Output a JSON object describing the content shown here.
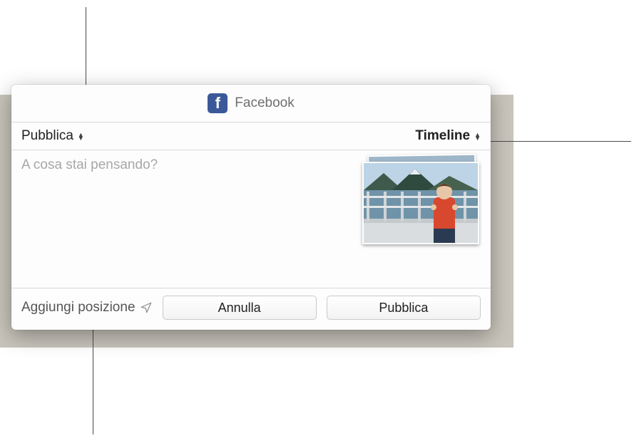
{
  "header": {
    "app_label": "Facebook"
  },
  "selectors": {
    "audience": "Pubblica",
    "destination": "Timeline"
  },
  "compose": {
    "placeholder": "A cosa stai pensando?"
  },
  "footer": {
    "add_location": "Aggiungi posizione",
    "cancel": "Annulla",
    "post": "Pubblica"
  }
}
